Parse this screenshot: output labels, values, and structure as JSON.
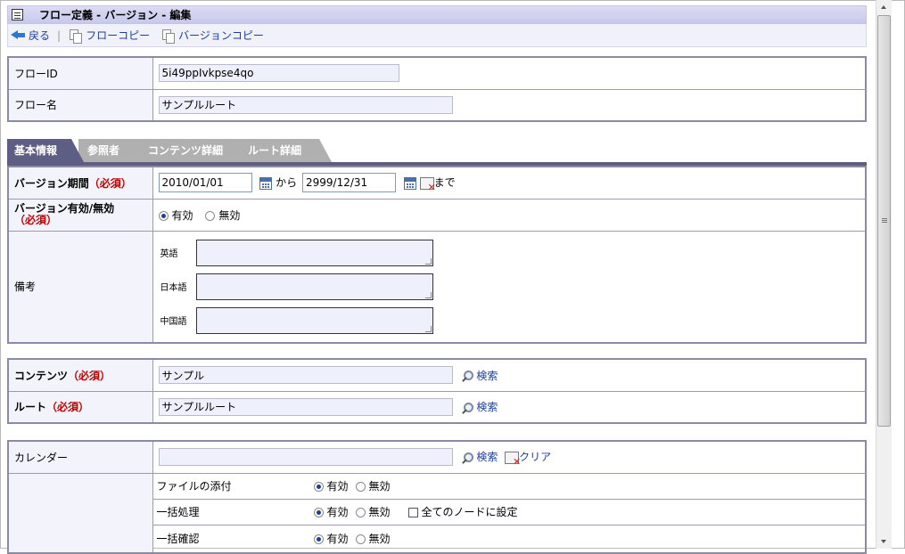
{
  "header": {
    "title": "フロー定義 - バージョン - 編集",
    "back_label": "戻る",
    "flow_copy_label": "フローコピー",
    "version_copy_label": "バージョンコピー"
  },
  "flow": {
    "id_label": "フローID",
    "id_value": "5i49ppIvkpse4qo",
    "name_label": "フロー名",
    "name_value": "サンプルルート"
  },
  "tabs": [
    {
      "label": "基本情報",
      "active": true
    },
    {
      "label": "参照者",
      "active": false
    },
    {
      "label": "コンテンツ詳細",
      "active": false
    },
    {
      "label": "ルート詳細",
      "active": false
    }
  ],
  "basic": {
    "period_label": "バージョン期間",
    "required_mark": "（必須）",
    "start_date": "2010/01/01",
    "from_label": "から",
    "end_date": "2999/12/31",
    "until_label": "まで",
    "valid_label": "バージョン有効/無効",
    "valid_option": "有効",
    "invalid_option": "無効",
    "notes_label": "備考",
    "notes_langs": [
      "英語",
      "日本語",
      "中国語"
    ]
  },
  "content": {
    "content_label": "コンテンツ",
    "content_value": "サンプル",
    "route_label": "ルート",
    "route_value": "サンプルルート",
    "search_label": "検索"
  },
  "settings": {
    "calendar_label": "カレンダー",
    "calendar_value": "",
    "search_label": "検索",
    "clear_label": "クリア",
    "rows": [
      {
        "label": "ファイルの添付",
        "on": "有効",
        "off": "無効"
      },
      {
        "label": "一括処理",
        "on": "有効",
        "off": "無効",
        "extra": "全てのノードに設定"
      },
      {
        "label": "一括確認",
        "on": "有効",
        "off": "無効"
      }
    ]
  }
}
